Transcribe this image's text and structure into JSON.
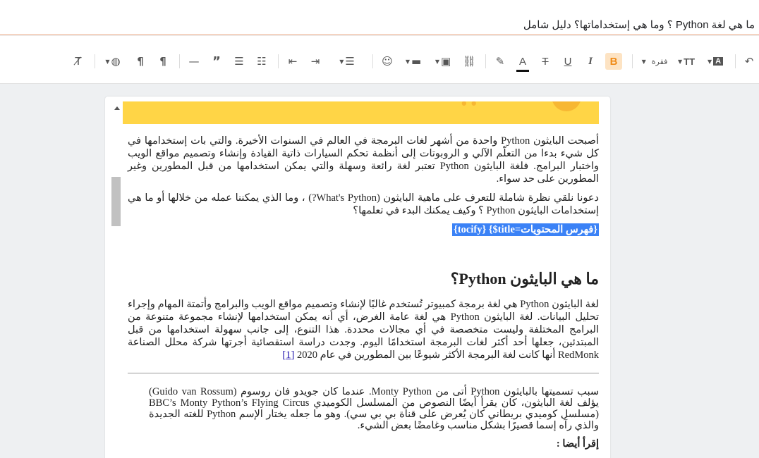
{
  "window": {
    "title": "ما هي لغة Python ؟ وما هي إستخداماتها؟ دليل شامل"
  },
  "toolbar": {
    "paragraph_label": "فقرة",
    "bold_label": "B",
    "italic_label": "I",
    "underline_label": "U",
    "strike_label": "T",
    "font_color_label": "A",
    "text_size_label": "TT",
    "items": [
      {
        "icon": "undo-icon"
      },
      {
        "icon": "font-family-icon"
      },
      {
        "icon": "text-size-icon"
      },
      {
        "icon": "paragraph-format-icon"
      },
      {
        "icon": "bold-icon"
      },
      {
        "icon": "italic-icon"
      },
      {
        "icon": "underline-icon"
      },
      {
        "icon": "strikethrough-icon"
      },
      {
        "icon": "text-color-icon"
      },
      {
        "icon": "highlight-icon"
      },
      {
        "icon": "link-icon"
      },
      {
        "icon": "image-icon"
      },
      {
        "icon": "video-icon"
      },
      {
        "icon": "emoji-icon"
      },
      {
        "icon": "align-icon"
      },
      {
        "icon": "indent-icon"
      },
      {
        "icon": "outdent-icon"
      },
      {
        "icon": "numbered-list-icon"
      },
      {
        "icon": "bullet-list-icon"
      },
      {
        "icon": "quote-icon"
      },
      {
        "icon": "horizontal-line-icon"
      },
      {
        "icon": "rtl-icon"
      },
      {
        "icon": "ltr-icon"
      },
      {
        "icon": "language-icon"
      },
      {
        "icon": "clear-format-icon"
      }
    ]
  },
  "editor": {
    "paragraph1": "أصبحت البايثون Python واحدة من أشهر لغات البرمجة في العالم في السنوات الأخيرة. والتي بات إستخدامها في كل شيء بدءا من التعلّم الآلي و الروبوتات إلى أنظمة تحكم السيارات ذاتية القيادة وإنشاء وتصميم مواقع الويب واختبار البرامج. فلغة البايثون Python تعتبر لغة رائعة وسهلة والتي يمكن استخدامها من قبل المطورين وغير المطورين على حد سواء.",
    "paragraph2": "دعونا نلقي نظرة شاملة للتعرف على ماهية البايثون (What's Python?) ، وما الذي يمكننا عمله من خلالها أو ما هي إستخدامات البايثون Python ؟ وكيف يمكنك البدء في تعلمها؟",
    "toc_shortcode": "{tocify} {$title=فهرس المحتويات}",
    "heading1": "ما هي البايثون Python؟",
    "paragraph3": "لغة البايثون Python هي لغة برمجة كمبيوتر تُستخدم غالبًا لإنشاء وتصميم مواقع الويب والبرامج وأتمتة المهام وإجراء تحليل البيانات. لغة البايثون Python هي لغة عامة الغرض، أي أنه يمكن استخدامها لإنشاء مجموعة متنوعة من البرامج المختلفة وليست متخصصة في أي مجالات محددة. هذا التنوع، إلى جانب سهولة استخدامها من قبل المبتدئين، جعلها أحد أكثر لغات البرمجة استخدامًا اليوم. وجدت دراسة استقصائية أجرتها شركة محلل الصناعة RedMonk أنها كانت لغة البرمجة الأكثر شيوعًا بين المطورين في عام 2020",
    "ref_link": "[1]",
    "footnote": "سبب تسميتها بالبايثون Python أتى من Monty Python. عندما كان جويدو فان روسوم (Guido van Rossum) يؤلف لغة البايثون، كان يقرأ أيضًا النصوص من المسلسل الكوميدي BBC’s Monty Python’s Flying Circus (مسلسل كوميدي بريطاني كان يُعرض على قناة بي بي سي). وهو ما جعله يختار الإسم Python للغته الجديدة والذي رآه إسما قصيرًا بشكل مناسب وغامضًا بعض الشيء.",
    "read_also": "إقرأ أيضا :"
  }
}
